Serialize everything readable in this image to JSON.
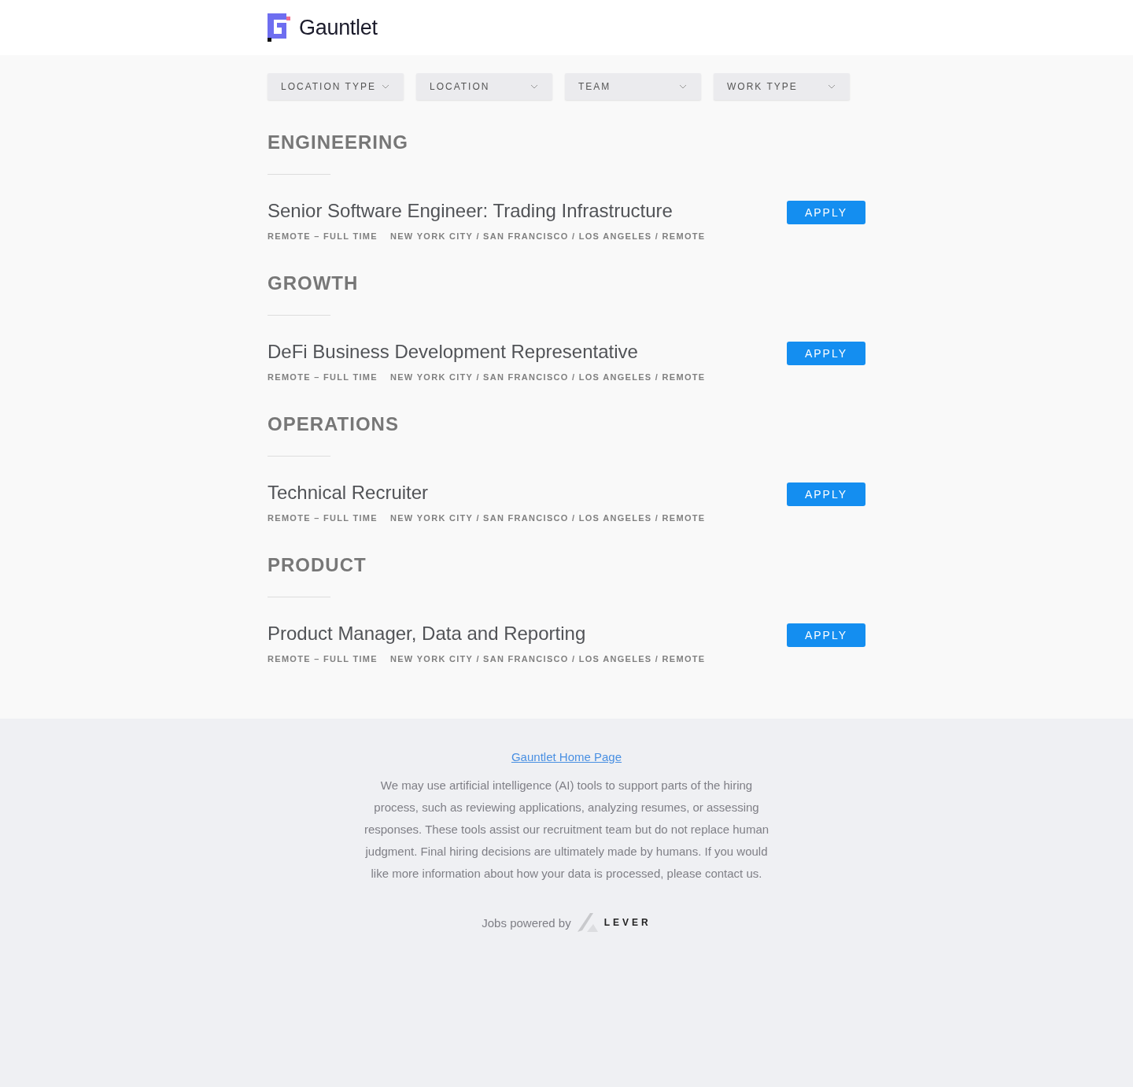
{
  "header": {
    "brand": "Gauntlet"
  },
  "filters": [
    {
      "label": "LOCATION TYPE"
    },
    {
      "label": "LOCATION"
    },
    {
      "label": "TEAM"
    },
    {
      "label": "WORK TYPE"
    }
  ],
  "groups": [
    {
      "heading": "ENGINEERING",
      "postings": [
        {
          "title": "Senior Software Engineer: Trading Infrastructure",
          "commitment": "REMOTE – FULL TIME",
          "location": "NEW YORK CITY / SAN FRANCISCO / LOS ANGELES / REMOTE",
          "button": "APPLY"
        }
      ]
    },
    {
      "heading": "GROWTH",
      "postings": [
        {
          "title": "DeFi Business Development Representative",
          "commitment": "REMOTE – FULL TIME",
          "location": "NEW YORK CITY / SAN FRANCISCO / LOS ANGELES / REMOTE",
          "button": "APPLY"
        }
      ]
    },
    {
      "heading": "OPERATIONS",
      "postings": [
        {
          "title": "Technical Recruiter",
          "commitment": "REMOTE – FULL TIME",
          "location": "NEW YORK CITY / SAN FRANCISCO / LOS ANGELES / REMOTE",
          "button": "APPLY"
        }
      ]
    },
    {
      "heading": "PRODUCT",
      "postings": [
        {
          "title": "Product Manager, Data and Reporting",
          "commitment": "REMOTE – FULL TIME",
          "location": "NEW YORK CITY / SAN FRANCISCO / LOS ANGELES / REMOTE",
          "button": "APPLY"
        }
      ]
    }
  ],
  "footer": {
    "link": "Gauntlet Home Page",
    "notice": "We may use artificial intelligence (AI) tools to support parts of the hiring process, such as reviewing applications, analyzing resumes, or assessing responses. These tools assist our recruitment team but do not replace human judgment. Final hiring decisions are ultimately made by humans. If you would like more information about how your data is processed, please contact us.",
    "powered_by": "Jobs powered by",
    "lever": "LEVER"
  }
}
